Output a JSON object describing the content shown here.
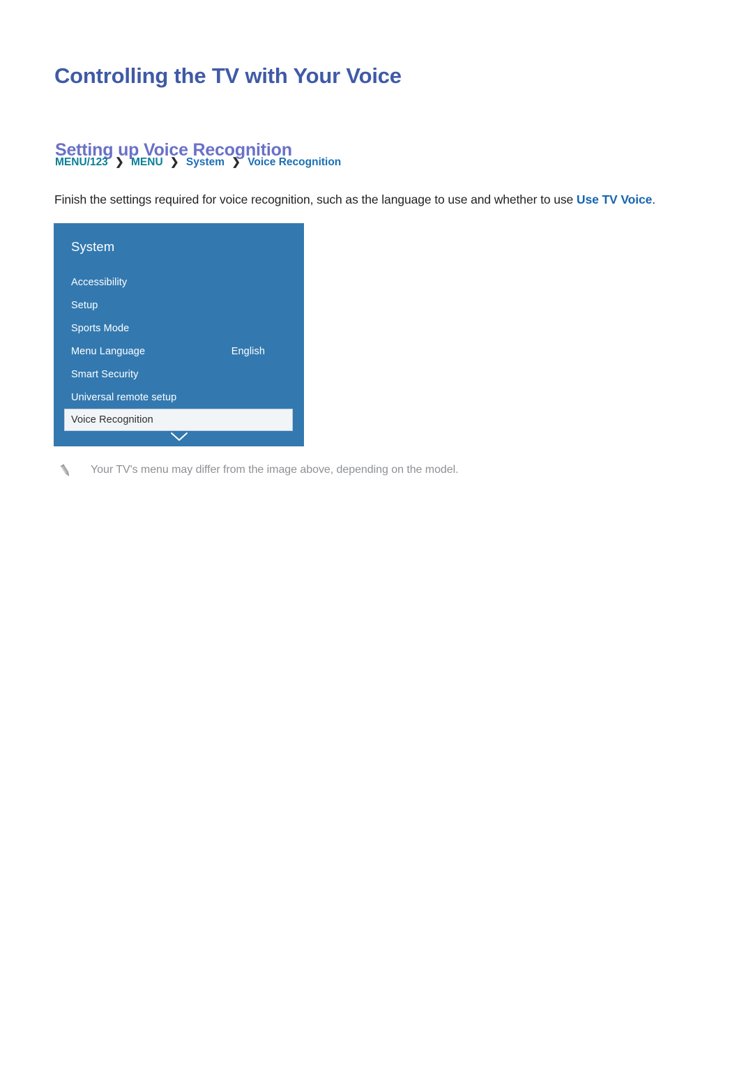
{
  "page": {
    "title": "Controlling the TV with Your Voice",
    "section_title": "Setting up Voice Recognition"
  },
  "breadcrumb": {
    "separator": "❯",
    "items": [
      {
        "label": "MENU/123",
        "color": "#0b7f98"
      },
      {
        "label": "MENU",
        "color": "#0b7f98"
      },
      {
        "label": "System",
        "color": "#1b6fb5"
      },
      {
        "label": "Voice Recognition",
        "color": "#1b6fb5"
      }
    ]
  },
  "intro": {
    "text_before": "Finish the settings required for voice recognition, such as the language to use and whether to use ",
    "link_text": "Use TV Voice",
    "text_after": "."
  },
  "tv_menu": {
    "panel_title": "System",
    "panel_color": "#3379b0",
    "selected_row_bg": "#f1f5f7",
    "rows": [
      {
        "label": "Accessibility",
        "value": "",
        "selected": false
      },
      {
        "label": "Setup",
        "value": "",
        "selected": false
      },
      {
        "label": "Sports Mode",
        "value": "",
        "selected": false
      },
      {
        "label": "Menu Language",
        "value": "English",
        "selected": false
      },
      {
        "label": "Smart Security",
        "value": "",
        "selected": false
      },
      {
        "label": "Universal remote setup",
        "value": "",
        "selected": false
      },
      {
        "label": "Voice Recognition",
        "value": "",
        "selected": true
      }
    ],
    "scroll_icon": "chevron-down-icon"
  },
  "note": {
    "icon": "pencil-icon",
    "text": "Your TV's menu may differ from the image above, depending on the model."
  }
}
